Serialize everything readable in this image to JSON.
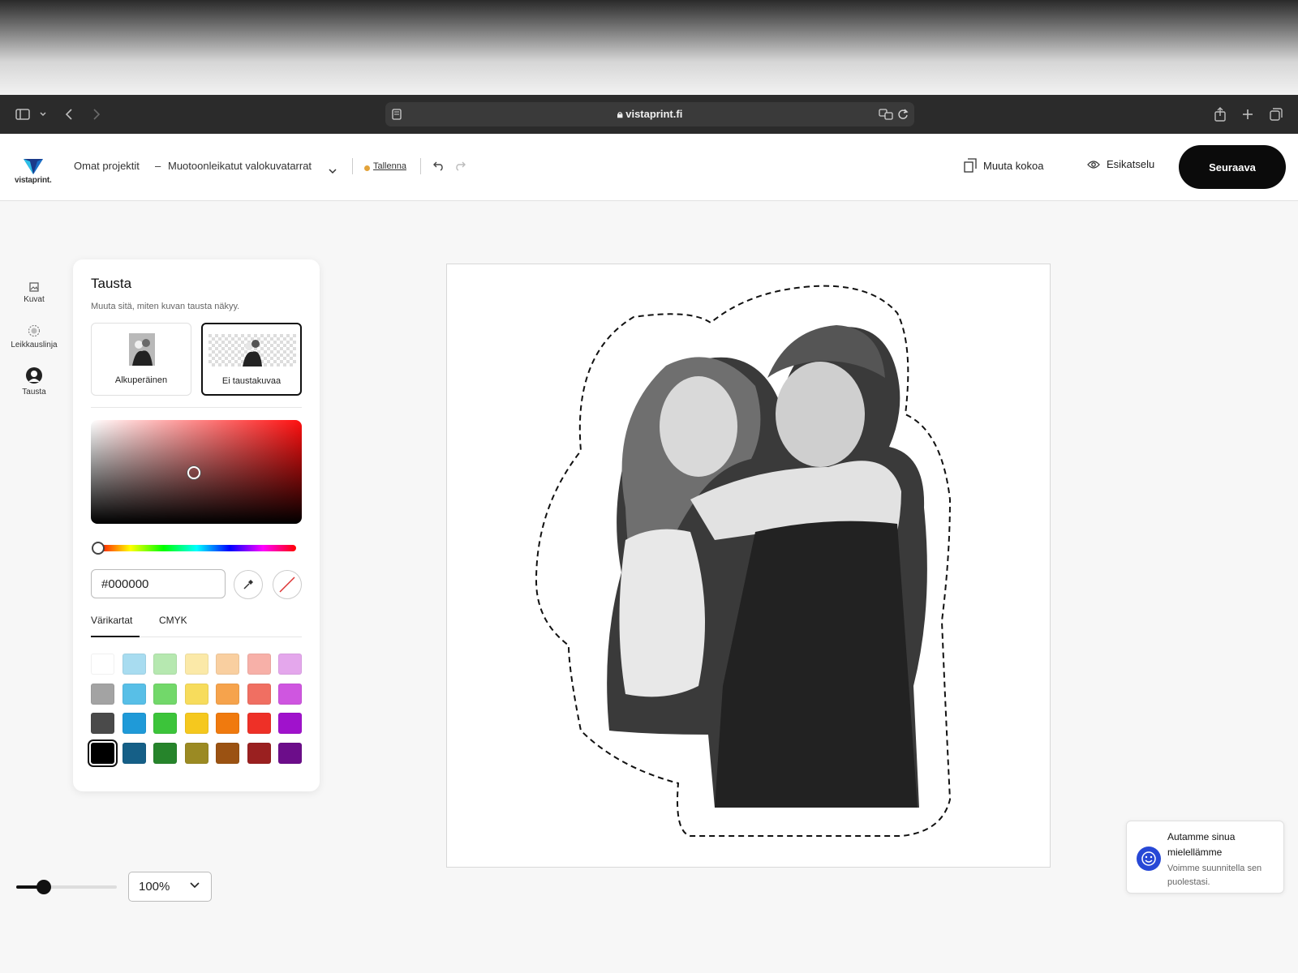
{
  "browser": {
    "url": "vistaprint.fi"
  },
  "header": {
    "logo_text": "vistaprint.",
    "breadcrumb_projects": "Omat projektit",
    "breadcrumb_separator": "–",
    "project_name": "Muotoonleikatut valokuvatarrat",
    "save_label": "Tallenna",
    "resize_label": "Muuta kokoa",
    "preview_label": "Esikatselu",
    "next_label": "Seuraava"
  },
  "rail": {
    "items": [
      {
        "label": "Kuvat",
        "icon": "image-icon"
      },
      {
        "label": "Leikkauslinja",
        "icon": "cutline-icon"
      },
      {
        "label": "Tausta",
        "icon": "background-icon"
      }
    ]
  },
  "panel": {
    "title": "Tausta",
    "subtitle": "Muuta sitä, miten kuvan tausta näkyy.",
    "options": [
      {
        "label": "Alkuperäinen",
        "selected": false
      },
      {
        "label": "Ei taustakuvaa",
        "selected": true
      }
    ],
    "hex_value": "#000000",
    "tabs": [
      "Värikartat",
      "CMYK"
    ],
    "active_tab": "Värikartat",
    "swatches": [
      [
        "#ffffff",
        "#a8dcf0",
        "#b6e8b0",
        "#fbe9a8",
        "#f9cfa0",
        "#f7b0a8",
        "#e4a7ec"
      ],
      [
        "#a3a3a3",
        "#58bfe7",
        "#72d86a",
        "#f7dc5c",
        "#f6a34c",
        "#f06f62",
        "#cf56e0"
      ],
      [
        "#4a4a4a",
        "#1f9ad8",
        "#3cc43a",
        "#f5c81e",
        "#f07a0e",
        "#ee3027",
        "#a012cc"
      ],
      [
        "#000000",
        "#155f87",
        "#26842b",
        "#9b8a23",
        "#9b5212",
        "#9a2020",
        "#6c0d8a"
      ]
    ],
    "selected_swatch": "#000000"
  },
  "zoom": {
    "value": "100%"
  },
  "help": {
    "title": "Autamme sinua mielellämme",
    "subtitle": "Voimme suunnitella sen puolestasi."
  }
}
